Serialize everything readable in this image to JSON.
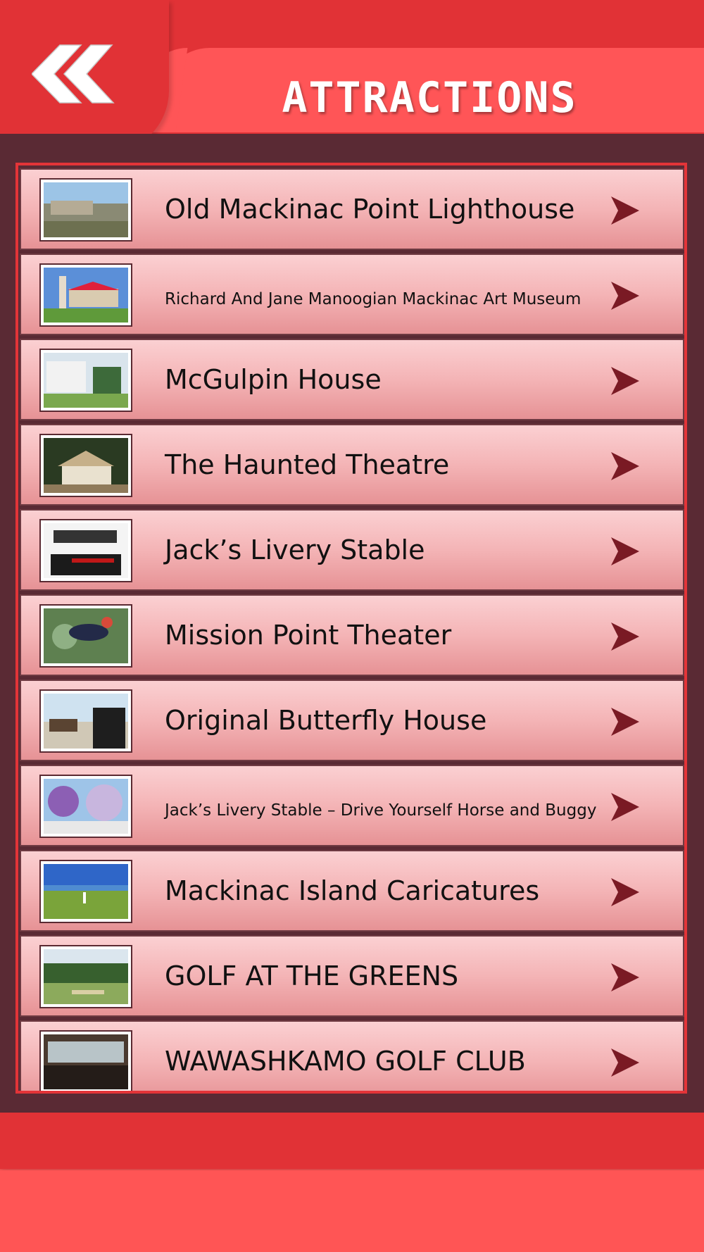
{
  "header": {
    "title": "ATTRACTIONS",
    "back_icon": "double-chevron-left-icon"
  },
  "colors": {
    "header_red": "#e13236",
    "tab_red": "#ff5557",
    "panel_maroon": "#5a2a34",
    "arrow_maroon": "#7a1a24"
  },
  "attractions": [
    {
      "label": "Old Mackinac Point Lighthouse",
      "small": false
    },
    {
      "label": "Richard And Jane Manoogian Mackinac Art Museum",
      "small": true
    },
    {
      "label": "McGulpin House",
      "small": false
    },
    {
      "label": "The Haunted Theatre",
      "small": false
    },
    {
      "label": "Jack’s Livery Stable",
      "small": false
    },
    {
      "label": "Mission Point Theater",
      "small": false
    },
    {
      "label": "Original Butterfly House",
      "small": false
    },
    {
      "label": "Jack’s Livery Stable – Drive Yourself Horse and Buggy",
      "small": true
    },
    {
      "label": "Mackinac Island Caricatures",
      "small": false
    },
    {
      "label": "GOLF AT THE GREENS",
      "small": false
    },
    {
      "label": "WAWASHKAMO GOLF CLUB",
      "small": false
    }
  ]
}
